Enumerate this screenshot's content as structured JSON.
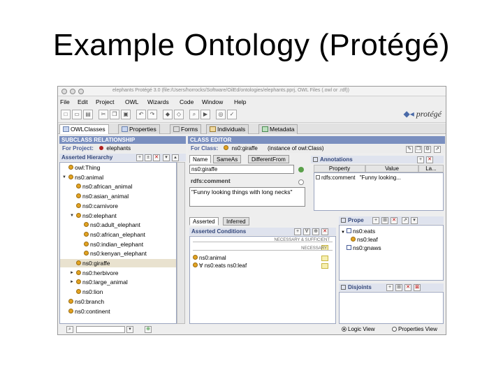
{
  "slide": {
    "title": "Example Ontology (Protégé)"
  },
  "window": {
    "title": "elephants Protégé 3.0 (file:/Users/horrocks/Software/OilEd/ontologies/elephants.pprj, OWL Files (.owl or .rdf))"
  },
  "menu": [
    "File",
    "Edit",
    "Project",
    "OWL",
    "Wizards",
    "Code",
    "Window",
    "Help"
  ],
  "logo": "protégé",
  "tabs": [
    {
      "label": "OWLClasses",
      "icon": "owl-classes-icon"
    },
    {
      "label": "Properties",
      "icon": "properties-icon"
    },
    {
      "label": "Forms",
      "icon": "forms-icon"
    },
    {
      "label": "Individuals",
      "icon": "individuals-icon"
    },
    {
      "label": "Metadata",
      "icon": "metadata-icon"
    }
  ],
  "left": {
    "header": "SUBCLASS RELATIONSHIP",
    "project_label": "For Project:",
    "project_name": "elephants",
    "hierarchy_label": "Asserted Hierarchy",
    "tree": [
      {
        "label": "owl:Thing",
        "depth": 0,
        "arrow": ""
      },
      {
        "label": "ns0:animal",
        "depth": 0,
        "arrow": "▼"
      },
      {
        "label": "ns0:african_animal",
        "depth": 1,
        "arrow": ""
      },
      {
        "label": "ns0:asian_animal",
        "depth": 1,
        "arrow": ""
      },
      {
        "label": "ns0:carnivore",
        "depth": 1,
        "arrow": ""
      },
      {
        "label": "ns0:elephant",
        "depth": 1,
        "arrow": "▼"
      },
      {
        "label": "ns0:adult_elephant",
        "depth": 2,
        "arrow": ""
      },
      {
        "label": "ns0:african_elephant",
        "depth": 2,
        "arrow": ""
      },
      {
        "label": "ns0:indian_elephant",
        "depth": 2,
        "arrow": ""
      },
      {
        "label": "ns0:kenyan_elephant",
        "depth": 2,
        "arrow": ""
      },
      {
        "label": "ns0:giraffe",
        "depth": 1,
        "arrow": "",
        "selected": true
      },
      {
        "label": "ns0:herbivore",
        "depth": 1,
        "arrow": "►"
      },
      {
        "label": "ns0:large_animal",
        "depth": 1,
        "arrow": "►"
      },
      {
        "label": "ns0:lion",
        "depth": 1,
        "arrow": ""
      },
      {
        "label": "ns0:branch",
        "depth": 0,
        "arrow": ""
      },
      {
        "label": "ns0:continent",
        "depth": 0,
        "arrow": ""
      }
    ]
  },
  "right": {
    "header": "CLASS EDITOR",
    "class_label": "For Class:",
    "class_name": "ns0:giraffe",
    "instance_of": "(instance of owl:Class)",
    "name_tabs": [
      "Name",
      "SameAs",
      "DifferentFrom"
    ],
    "name_value": "ns0:giraffe",
    "rdfs_comment_label": "rdfs:comment",
    "comment_value": "\"Funny looking things with long necks\"",
    "annotations": {
      "label": "Annotations",
      "columns": [
        "Property",
        "Value",
        "La..."
      ],
      "row_property": "rdfs:comment",
      "row_value": "\"Funny looking..."
    },
    "cond_tabs": [
      "Asserted",
      "Inferred"
    ],
    "asserted_label": "Asserted Conditions",
    "nec_suff": "NECESSARY & SUFFICIENT",
    "necessary": "NECESSARY",
    "conditions": [
      "ns0:animal",
      "∀ ns0:eats ns0:leaf"
    ],
    "props": {
      "label": "Prope",
      "items": [
        {
          "label": "ns0:eats",
          "depth": 0,
          "arrow": "▼"
        },
        {
          "label": "ns0:leaf",
          "depth": 1,
          "arrow": ""
        },
        {
          "label": "ns0:gnaws",
          "depth": 0,
          "arrow": ""
        }
      ]
    },
    "disjoints_label": "Disjoints",
    "view_options": [
      "Logic View",
      "Properties View"
    ]
  }
}
